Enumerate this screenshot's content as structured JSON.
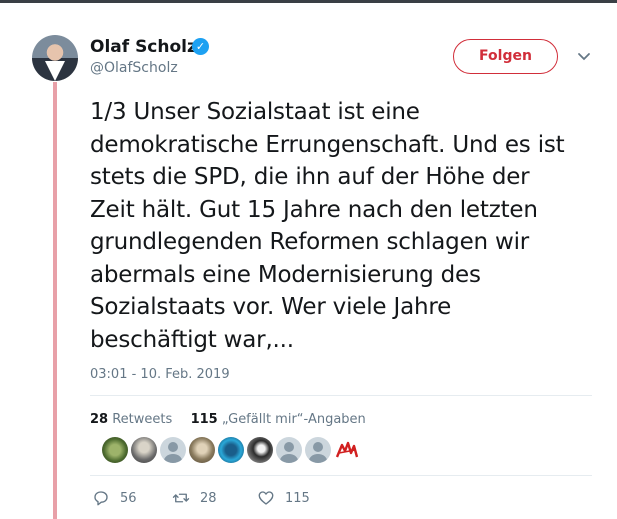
{
  "author": {
    "name": "Olaf Scholz",
    "handle": "@OlafScholz",
    "verified_glyph": "✓"
  },
  "follow_button": {
    "label": "Folgen"
  },
  "tweet": {
    "lines": [
      "1/3 Unser Sozialstaat ist eine",
      "demokratische Errungenschaft. Und es ist",
      "stets die SPD, die ihn auf der Höhe der",
      "Zeit hält. Gut 15 Jahre nach den letzten",
      "grundlegenden Reformen schlagen wir",
      "abermals eine Modernisierung des",
      "Sozialstaats vor. Wer viele Jahre",
      "beschäftigt war,..."
    ],
    "timestamp": "03:01 - 10. Feb. 2019"
  },
  "stats": {
    "retweets_count": "28",
    "retweets_label": "Retweets",
    "likes_count": "115",
    "likes_label": "„Gefällt mir“-Angaben"
  },
  "liker_avatars": [
    "photo-green",
    "photo-gray",
    "default",
    "photo-brown",
    "photo-blue",
    "photo-dark",
    "default",
    "default",
    "logo-red"
  ],
  "actions": {
    "reply_count": "56",
    "retweet_count": "28",
    "like_count": "115"
  },
  "colors": {
    "accent_red": "#d12e3a",
    "thread_line": "#e8a0a8",
    "verified_blue": "#1da1f2",
    "muted_text": "#657786"
  }
}
